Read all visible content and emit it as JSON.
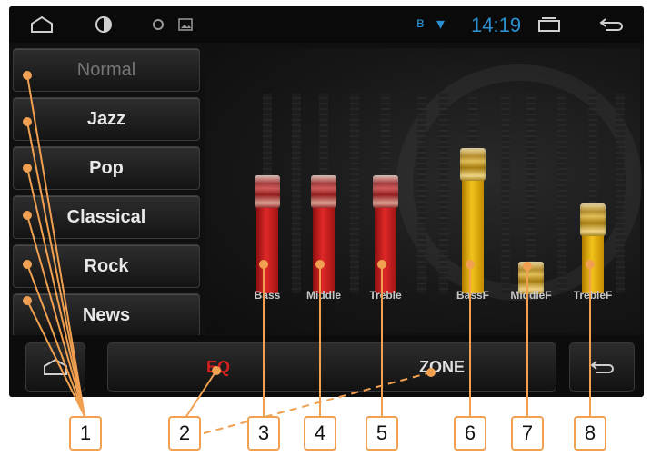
{
  "statusbar": {
    "time": "14:19",
    "icons": [
      "home-icon",
      "brightness-icon",
      "circle-icon",
      "gallery-icon",
      "bluetooth-icon",
      "wifi-icon",
      "recent-apps-icon",
      "back-icon"
    ]
  },
  "presets": [
    {
      "label": "Normal",
      "active": false
    },
    {
      "label": "Jazz",
      "active": true
    },
    {
      "label": "Pop",
      "active": true
    },
    {
      "label": "Classical",
      "active": true
    },
    {
      "label": "Rock",
      "active": true
    },
    {
      "label": "News",
      "active": true
    }
  ],
  "bands": [
    {
      "label": "Bass",
      "color": "#e02828",
      "level": 0.58
    },
    {
      "label": "Middle",
      "color": "#e02828",
      "level": 0.58
    },
    {
      "label": "Treble",
      "color": "#e02828",
      "level": 0.58
    },
    {
      "label": "BassF",
      "color": "#f2c31b",
      "level": 0.72
    },
    {
      "label": "MiddleF",
      "color": "#f2c31b",
      "level": 0.15
    },
    {
      "label": "TrebleF",
      "color": "#f2c31b",
      "level": 0.44
    }
  ],
  "bottom": {
    "eq_label": "EQ",
    "zone_label": "ZONE"
  },
  "callouts": [
    "1",
    "2",
    "3",
    "4",
    "5",
    "6",
    "7",
    "8"
  ],
  "colors": {
    "accent_red": "#d42020",
    "accent_blue": "#2a90d0",
    "callout_border": "#f0a050"
  }
}
